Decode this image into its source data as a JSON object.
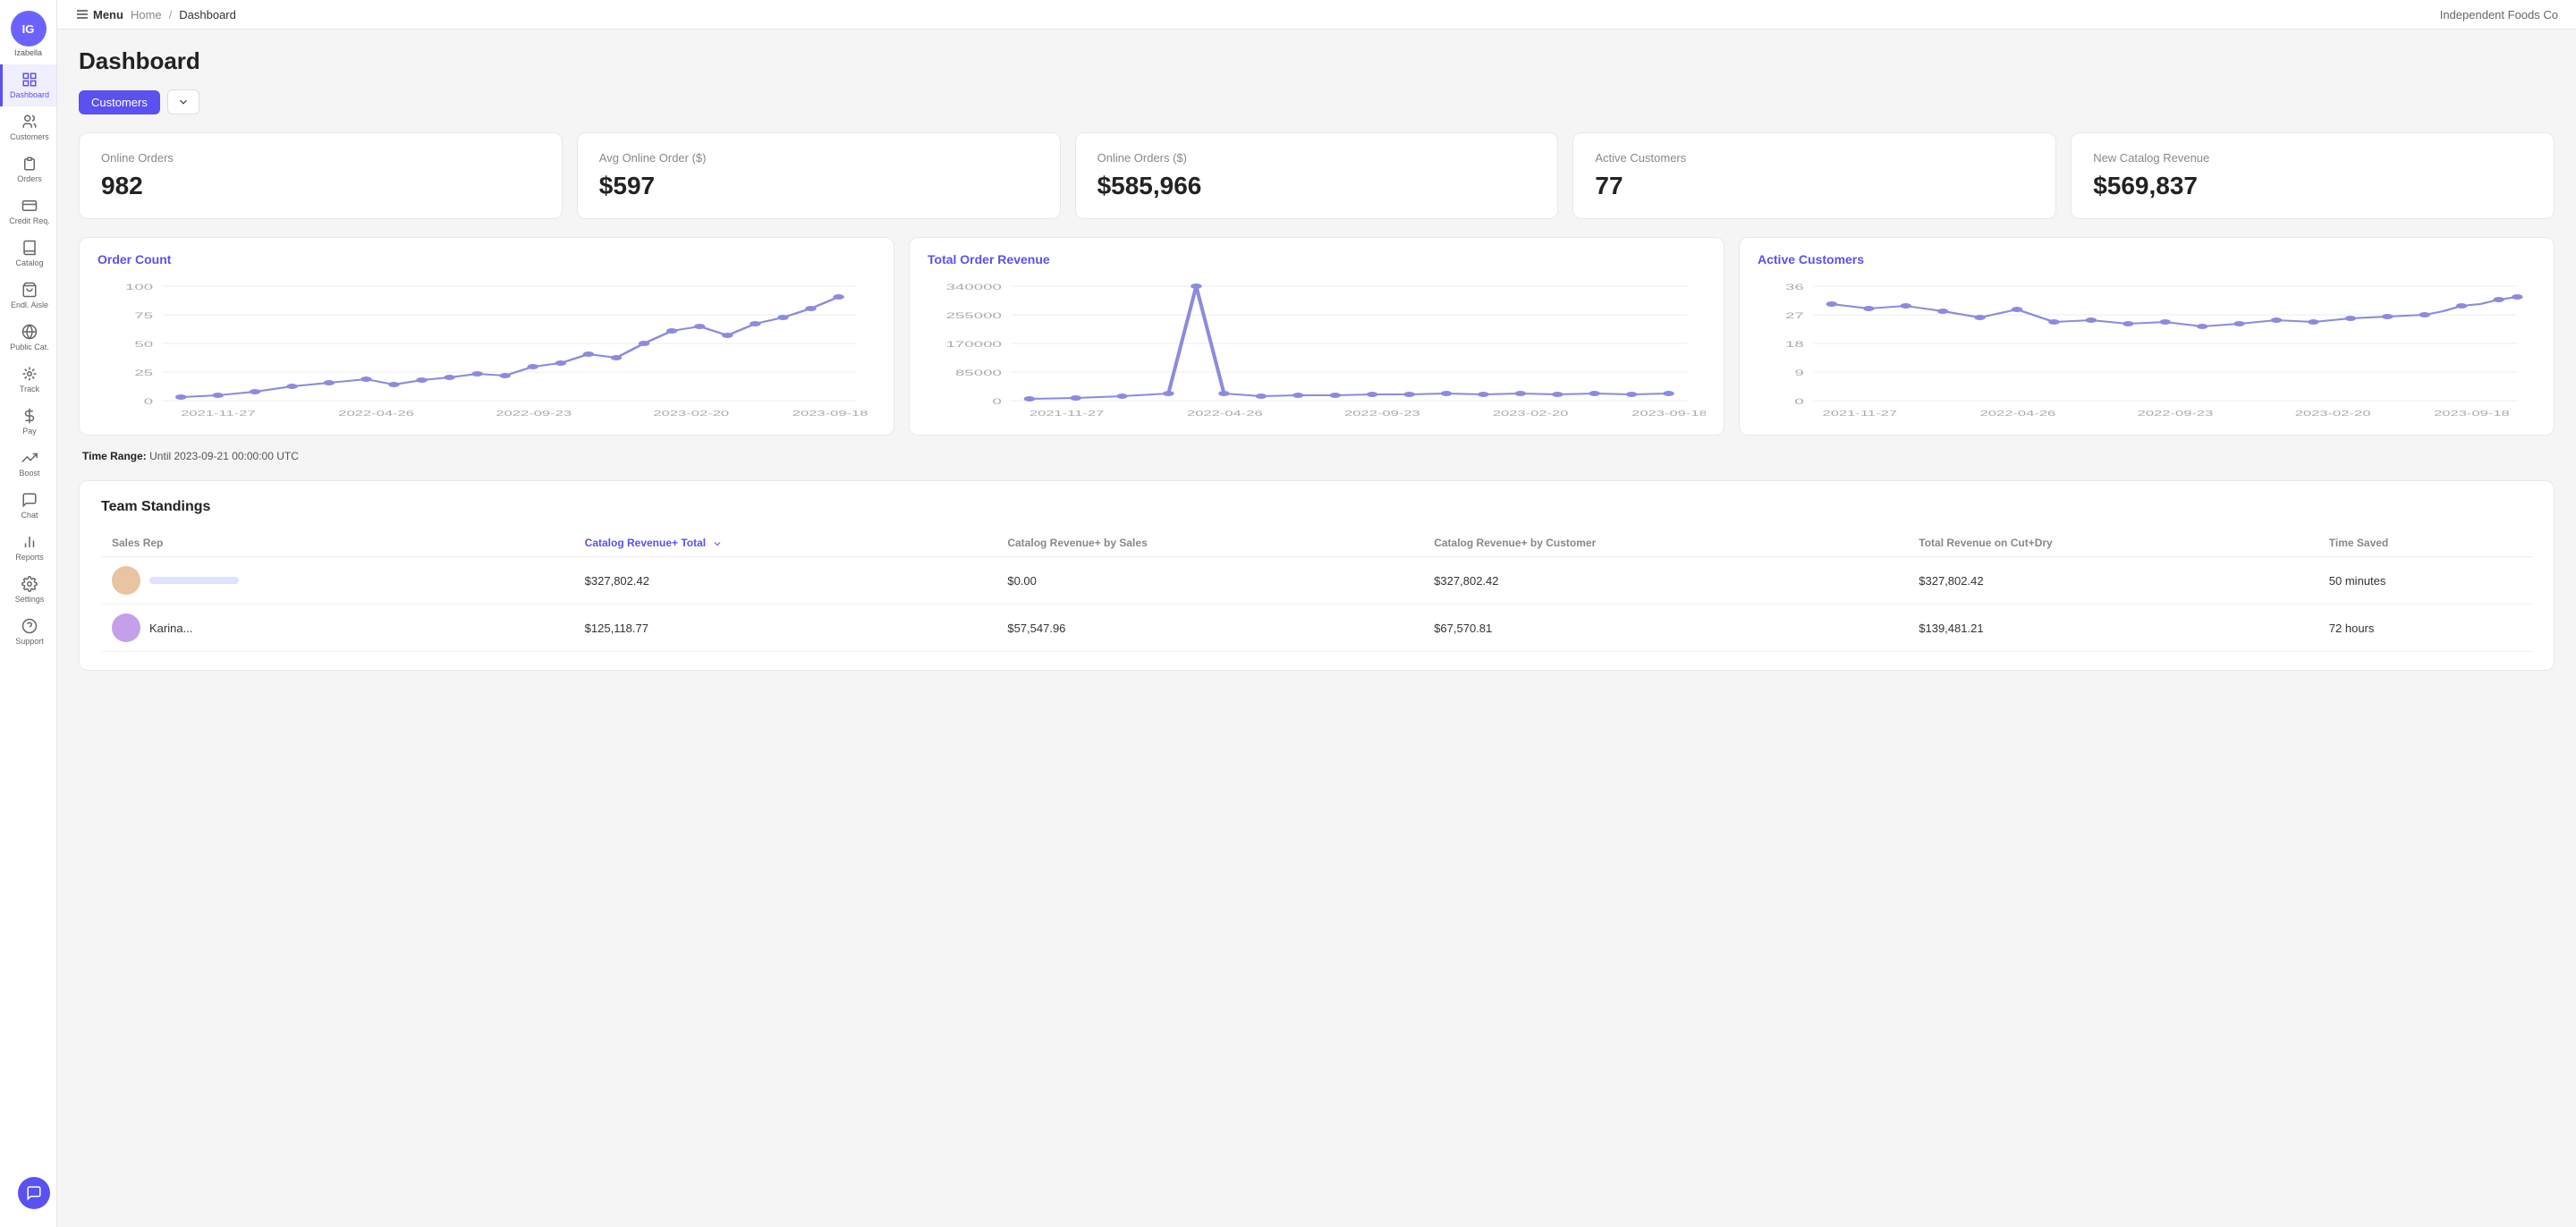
{
  "app": {
    "title": "Independent Foods Co",
    "user_initials": "IG",
    "user_name": "Izabella"
  },
  "topbar": {
    "menu_label": "Menu",
    "breadcrumb": [
      "Home",
      "Dashboard"
    ],
    "current": "Dashboard"
  },
  "sidebar": {
    "items": [
      {
        "id": "dashboard",
        "label": "Dashboard",
        "active": true
      },
      {
        "id": "customers",
        "label": "Customers",
        "active": false
      },
      {
        "id": "orders",
        "label": "Orders",
        "active": false
      },
      {
        "id": "credit-req",
        "label": "Credit Req.",
        "active": false
      },
      {
        "id": "catalog",
        "label": "Catalog",
        "active": false
      },
      {
        "id": "endl-aisle",
        "label": "Endl. Aisle",
        "active": false
      },
      {
        "id": "public-cat",
        "label": "Public Cat.",
        "active": false
      },
      {
        "id": "track",
        "label": "Track",
        "active": false
      },
      {
        "id": "pay",
        "label": "Pay",
        "active": false
      },
      {
        "id": "boost",
        "label": "Boost",
        "active": false
      },
      {
        "id": "chat",
        "label": "Chat",
        "active": false
      },
      {
        "id": "reports",
        "label": "Reports",
        "active": false
      },
      {
        "id": "settings",
        "label": "Settings",
        "active": false
      },
      {
        "id": "support",
        "label": "Support",
        "active": false
      }
    ]
  },
  "page": {
    "title": "Dashboard"
  },
  "filter": {
    "tag": "Customers",
    "dropdown_placeholder": ""
  },
  "stats": [
    {
      "label": "Online Orders",
      "value": "982"
    },
    {
      "label": "Avg Online Order ($)",
      "value": "$597"
    },
    {
      "label": "Online Orders ($)",
      "value": "$585,966"
    },
    {
      "label": "Active Customers",
      "value": "77"
    },
    {
      "label": "New Catalog Revenue",
      "value": "$569,837"
    }
  ],
  "charts": [
    {
      "id": "order-count",
      "title": "Order Count",
      "y_labels": [
        "100",
        "75",
        "50",
        "25",
        "0"
      ],
      "x_labels": [
        "2021-11-27",
        "2022-04-26",
        "2022-09-23",
        "2023-02-20",
        "2023-09-18"
      ]
    },
    {
      "id": "total-order-revenue",
      "title": "Total Order Revenue",
      "y_labels": [
        "340000",
        "255000",
        "170000",
        "85000",
        "0"
      ],
      "x_labels": [
        "2021-11-27",
        "2022-04-26",
        "2022-09-23",
        "2023-02-20",
        "2023-09-18"
      ]
    },
    {
      "id": "active-customers",
      "title": "Active Customers",
      "y_labels": [
        "36",
        "27",
        "18",
        "9",
        "0"
      ],
      "x_labels": [
        "2021-11-27",
        "2022-04-26",
        "2022-09-23",
        "2023-02-20",
        "2023-09-18"
      ]
    }
  ],
  "time_range": {
    "label": "Time Range:",
    "value": "Until 2023-09-21 00:00:00 UTC"
  },
  "team_standings": {
    "title": "Team Standings",
    "columns": [
      {
        "id": "sales-rep",
        "label": "Sales Rep",
        "sortable": false
      },
      {
        "id": "catalog-revenue-total",
        "label": "Catalog Revenue+ Total",
        "sortable": true
      },
      {
        "id": "catalog-revenue-by-sales",
        "label": "Catalog Revenue+ by Sales",
        "sortable": false
      },
      {
        "id": "catalog-revenue-by-customer",
        "label": "Catalog Revenue+ by Customer",
        "sortable": false
      },
      {
        "id": "total-revenue-cutdry",
        "label": "Total Revenue on Cut+Dry",
        "sortable": false
      },
      {
        "id": "time-saved",
        "label": "Time Saved",
        "sortable": false
      }
    ],
    "rows": [
      {
        "name": "",
        "avatar_color": "#e8c4a0",
        "catalog_total": "$327,802.42",
        "by_sales": "$0.00",
        "by_customer": "$327,802.42",
        "total_revenue": "$327,802.42",
        "time_saved": "50 minutes"
      },
      {
        "name": "Karina...",
        "avatar_color": "#c4a0e8",
        "catalog_total": "$125,118.77",
        "by_sales": "$57,547.96",
        "by_customer": "$67,570.81",
        "total_revenue": "$139,481.21",
        "time_saved": "72 hours"
      }
    ]
  }
}
